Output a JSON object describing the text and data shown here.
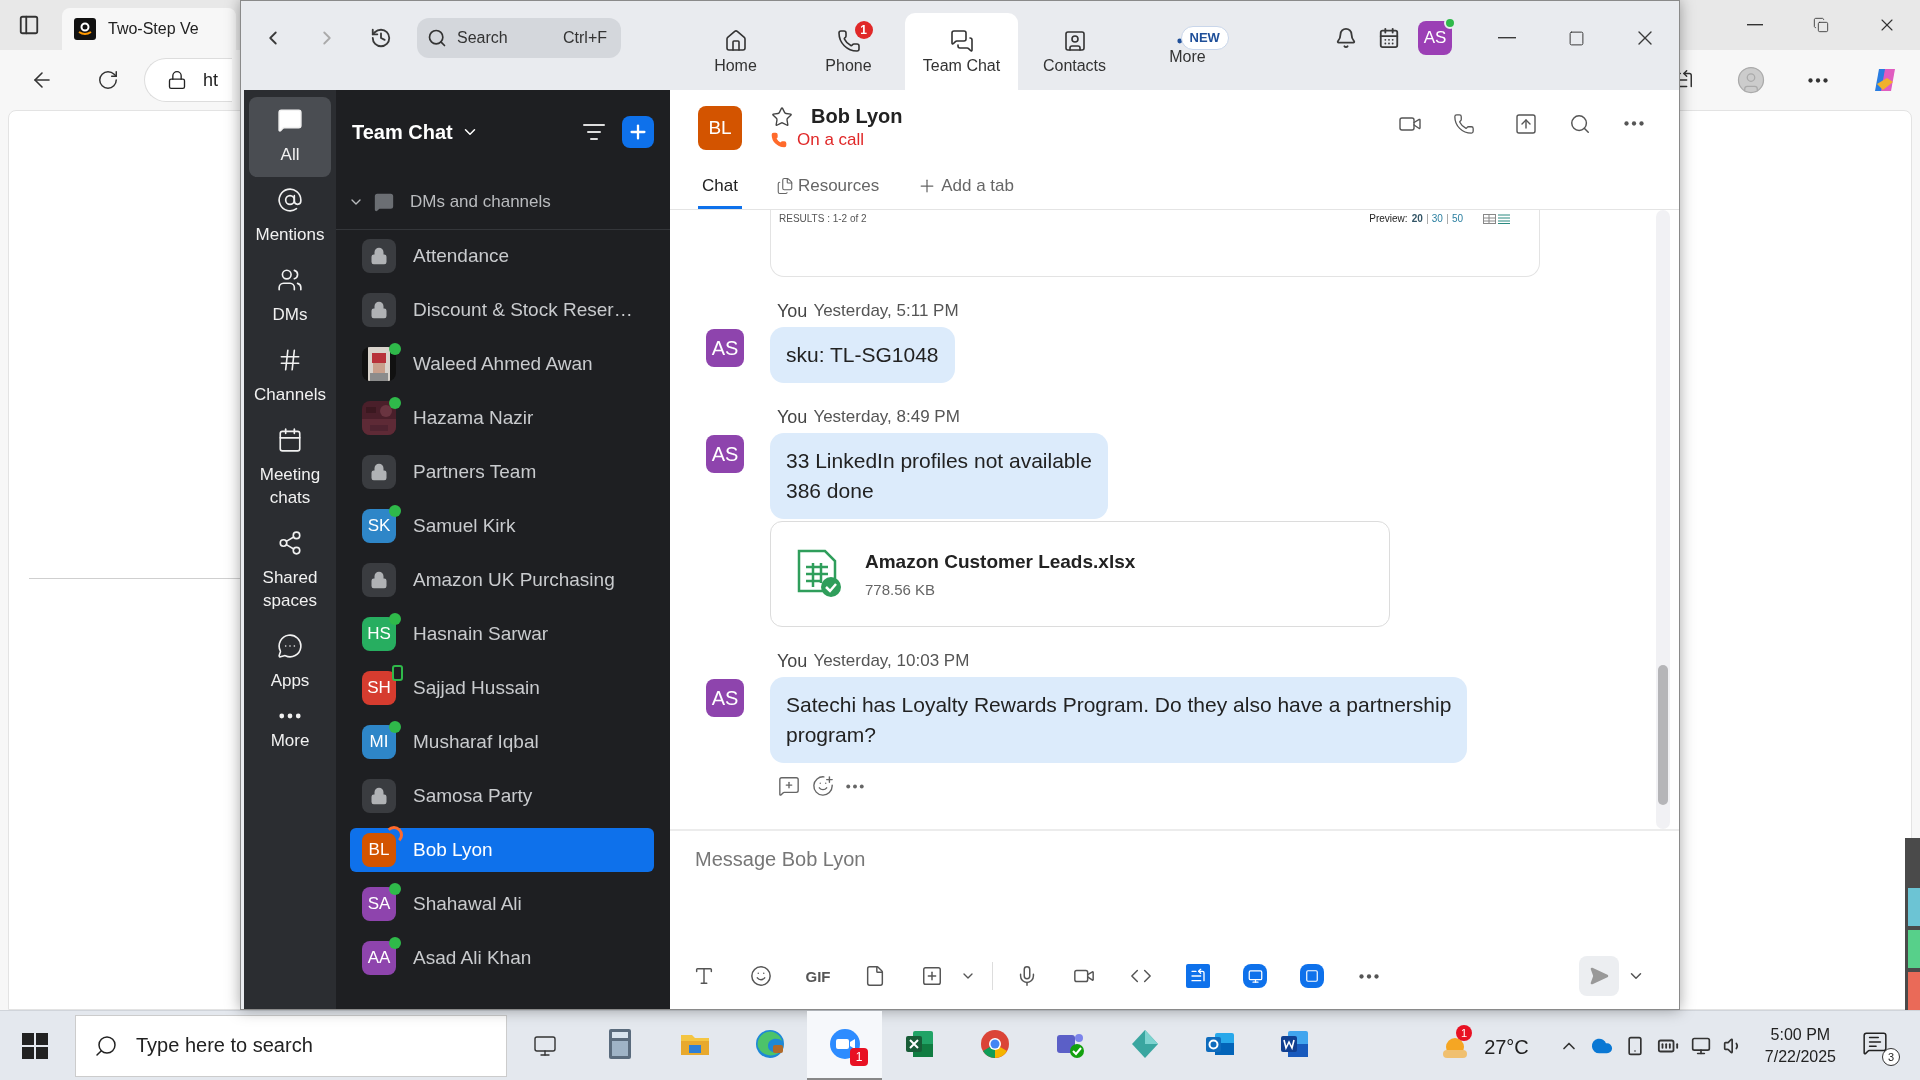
{
  "browser": {
    "tab": {
      "title": "Two-Step Ve"
    },
    "address": {
      "value": "ht"
    }
  },
  "zoom": {
    "search": {
      "placeholder": "Search",
      "shortcut": "Ctrl+F"
    },
    "nav": [
      {
        "kind": "home",
        "label": "Home",
        "selected": false
      },
      {
        "kind": "phone",
        "label": "Phone",
        "badge": "1",
        "selected": false
      },
      {
        "kind": "chat",
        "label": "Team Chat",
        "selected": true
      },
      {
        "kind": "contacts",
        "label": "Contacts",
        "selected": false
      },
      {
        "kind": "more",
        "label": "More",
        "tag": "NEW",
        "selected": false
      }
    ],
    "profile": {
      "initials": "AS",
      "online": true
    },
    "rail": [
      {
        "kind": "all",
        "label": "All",
        "selected": true
      },
      {
        "kind": "mentions",
        "label": "Mentions",
        "selected": false
      },
      {
        "kind": "dms",
        "label": "DMs",
        "selected": false
      },
      {
        "kind": "channels",
        "label": "Channels",
        "selected": false
      },
      {
        "kind": "meetings",
        "label": "Meeting chats",
        "selected": false
      },
      {
        "kind": "shared",
        "label": "Shared spaces",
        "selected": false
      },
      {
        "kind": "apps",
        "label": "Apps",
        "selected": false
      },
      {
        "kind": "more",
        "label": "More",
        "selected": false
      }
    ],
    "list": {
      "title": "Team Chat",
      "section": {
        "label": "DMs and channels",
        "expanded": true
      },
      "items": [
        {
          "name": "Attendance",
          "kind": "lock",
          "selected": false
        },
        {
          "name": "Discount & Stock Reser…",
          "kind": "lock",
          "selected": false
        },
        {
          "name": "Waleed Ahmed Awan",
          "status": {
            "kind": "online"
          },
          "selected": false
        },
        {
          "name": "Hazama Nazir",
          "status": {
            "kind": "online"
          },
          "selected": false
        },
        {
          "name": "Partners Team",
          "kind": "lock",
          "selected": false
        },
        {
          "name": "Samuel Kirk",
          "kind": "initials",
          "initials": "SK",
          "color": "#2e86c8",
          "status": {
            "kind": "online"
          },
          "selected": false
        },
        {
          "name": "Amazon UK Purchasing",
          "kind": "lock",
          "selected": false
        },
        {
          "name": "Hasnain Sarwar",
          "kind": "initials",
          "initials": "HS",
          "color": "#27ae60",
          "status": {
            "kind": "online"
          },
          "selected": false
        },
        {
          "name": "Sajjad Hussain",
          "kind": "initials",
          "initials": "SH",
          "color": "#d63c2f",
          "status": {
            "kind": "mobile"
          },
          "selected": false
        },
        {
          "name": "Musharaf Iqbal",
          "kind": "initials",
          "initials": "MI",
          "color": "#2e86c8",
          "status": {
            "kind": "online"
          },
          "selected": false
        },
        {
          "name": "Samosa Party",
          "kind": "lock",
          "selected": false
        },
        {
          "name": "Bob Lyon",
          "kind": "initials",
          "initials": "BL",
          "color": "#d35400",
          "status": {
            "kind": "call"
          },
          "selected": true
        },
        {
          "name": "Shahawal Ali",
          "kind": "initials",
          "initials": "SA",
          "color": "#8e44ad",
          "status": {
            "kind": "online"
          },
          "selected": false
        },
        {
          "name": "Asad Ali Khan",
          "kind": "initials",
          "initials": "AA",
          "color": "#8e44ad",
          "status": {
            "kind": "online"
          },
          "selected": false
        }
      ]
    },
    "chat": {
      "initials": "BL",
      "color": "#d35400",
      "name": "Bob Lyon",
      "starred": false,
      "status": "On a call",
      "tabs": [
        {
          "kind": "chat",
          "label": "Chat",
          "selected": true
        },
        {
          "kind": "resources",
          "label": "Resources",
          "selected": false
        },
        {
          "kind": "add",
          "label": "Add a tab",
          "selected": false
        }
      ],
      "results_card": {
        "results": "RESULTS : 1-2 of 2",
        "preview_label": "Preview:",
        "preview_options": [
          {
            "label": "20",
            "selected": true
          },
          {
            "label": "30",
            "selected": false
          },
          {
            "label": "50",
            "selected": false
          }
        ]
      },
      "messages": [
        {
          "sender": "You",
          "time": "Yesterday, 5:11 PM",
          "initials": "AS",
          "lines": [
            "sku: TL-SG1048"
          ]
        },
        {
          "sender": "You",
          "time": "Yesterday, 8:49 PM",
          "initials": "AS",
          "lines": [
            "33 LinkedIn profiles not available",
            "386 done"
          ],
          "attachment": {
            "name": "Amazon Customer Leads.xlsx",
            "size": "778.56 KB"
          }
        },
        {
          "sender": "You",
          "time": "Yesterday, 10:03 PM",
          "initials": "AS",
          "lines": [
            "Satechi has Loyalty Rewards Program. Do they also have a partnership",
            "program?"
          ],
          "hover_actions": true
        }
      ],
      "composer": {
        "placeholder": "Message Bob Lyon",
        "tools": [
          {
            "kind": "text"
          },
          {
            "kind": "emoji"
          },
          {
            "kind": "gif",
            "label": "GIF"
          },
          {
            "kind": "file"
          },
          {
            "kind": "screenshot"
          },
          {
            "kind": "caret"
          },
          {
            "kind": "divider"
          },
          {
            "kind": "mic"
          },
          {
            "kind": "video"
          },
          {
            "kind": "code"
          },
          {
            "kind": "doc-app"
          },
          {
            "kind": "whiteboard-app"
          },
          {
            "kind": "clip-app"
          },
          {
            "kind": "more"
          }
        ]
      }
    }
  },
  "taskbar": {
    "search": {
      "placeholder": "Type here to search"
    },
    "apps": [
      {
        "kind": "calculator",
        "active": false
      },
      {
        "kind": "folder",
        "active": false
      },
      {
        "kind": "edge",
        "active": false
      },
      {
        "kind": "zoom",
        "active": true,
        "badge": "1"
      },
      {
        "kind": "excel",
        "active": false
      },
      {
        "kind": "chrome",
        "active": false
      },
      {
        "kind": "teams",
        "active": false
      },
      {
        "kind": "diamond",
        "active": false
      },
      {
        "kind": "outlook",
        "active": false
      },
      {
        "kind": "word",
        "active": false
      }
    ],
    "weather": {
      "badge": "1",
      "temperature": "27°C"
    },
    "clock": {
      "time": "5:00 PM",
      "date": "7/22/2025"
    },
    "notifications": "3"
  }
}
